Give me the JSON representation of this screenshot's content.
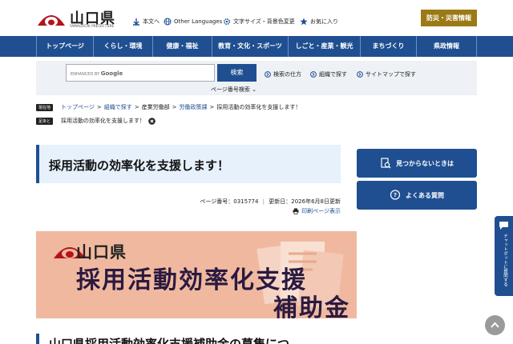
{
  "header": {
    "logo_text": "山口県",
    "logo_sub": "YAMAGUCHI PREFECTURE",
    "util_links": [
      {
        "label": "本文へ",
        "icon": "arrow-down-icon"
      },
      {
        "label": "Other Languages",
        "icon": "globe-icon"
      },
      {
        "label": "文字サイズ・背景色変更",
        "icon": "gear-icon"
      },
      {
        "label": "お気に入り",
        "icon": "star-icon"
      }
    ],
    "disaster_label": "防災・災害情報"
  },
  "nav": {
    "items": [
      {
        "label": "トップページ"
      },
      {
        "label": "くらし・環境"
      },
      {
        "label": "健康・福祉"
      },
      {
        "label": "教育・文化・スポーツ"
      },
      {
        "label": "しごと・産業・観光"
      },
      {
        "label": "まちづくり"
      },
      {
        "label": "県政情報"
      }
    ]
  },
  "search": {
    "enhanced_by": "ENHANCED BY",
    "google": "Google",
    "button_label": "検索",
    "links": [
      {
        "label": "検索の仕方"
      },
      {
        "label": "組織で探す"
      },
      {
        "label": "サイトマップで探す"
      }
    ],
    "page_number_search": "ページ番号検索"
  },
  "breadcrumb": {
    "current_tag": "現在地",
    "items": [
      "トップページ",
      "組織で探す",
      "産業労働部",
      "労働政策課",
      "採用活動の効率化を支援します！"
    ],
    "history_tag": "足あと",
    "history_item": "採用活動の効率化を支援します！"
  },
  "page": {
    "title": "採用活動の効率化を支援します！",
    "page_number": "ページ番号：0315774",
    "updated": "更新日：2026年6月8日更新",
    "print_label": "印刷ページ表示",
    "subheading": "山口県採用活動効率化支援補助金の募集につ"
  },
  "banner": {
    "pref": "山口県",
    "line1": "採用活動効率化支援",
    "line2": "補助金"
  },
  "side": {
    "not_found": "見つからないときは",
    "faq": "よくある質問"
  },
  "chatbot": {
    "label": "チャットボットに質問する"
  },
  "colors": {
    "primary": "#1f4f91",
    "disaster": "#9b7a16",
    "title_bg": "#e6f1fb",
    "banner_bg": "#f0b99f"
  }
}
